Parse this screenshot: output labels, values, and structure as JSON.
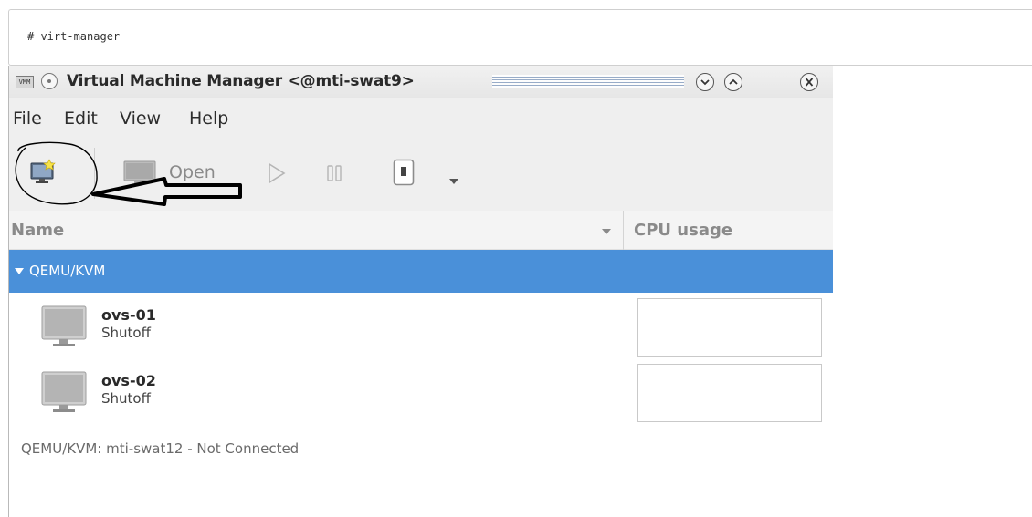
{
  "code": {
    "command": "# virt-manager"
  },
  "window": {
    "title": "Virtual Machine Manager <@mti-swat9>",
    "app_icon_text": "VMM",
    "controls": [
      "minimize",
      "maximize",
      "close"
    ]
  },
  "menubar": {
    "items": [
      "File",
      "Edit",
      "View",
      "Help"
    ]
  },
  "toolbar": {
    "open_label": "Open",
    "icons": [
      "new-vm-icon",
      "open-console-icon",
      "play-icon",
      "pause-icon",
      "shutdown-icon",
      "chevron-down-icon"
    ]
  },
  "columns": {
    "name": "Name",
    "cpu": "CPU usage"
  },
  "group": {
    "label": "QEMU/KVM"
  },
  "vms": [
    {
      "name": "ovs-01",
      "state": "Shutoff"
    },
    {
      "name": "ovs-02",
      "state": "Shutoff"
    }
  ],
  "connection": {
    "status": "QEMU/KVM: mti-swat12 - Not Connected"
  },
  "colors": {
    "selection": "#4a90d9",
    "annotation": "#000000"
  }
}
